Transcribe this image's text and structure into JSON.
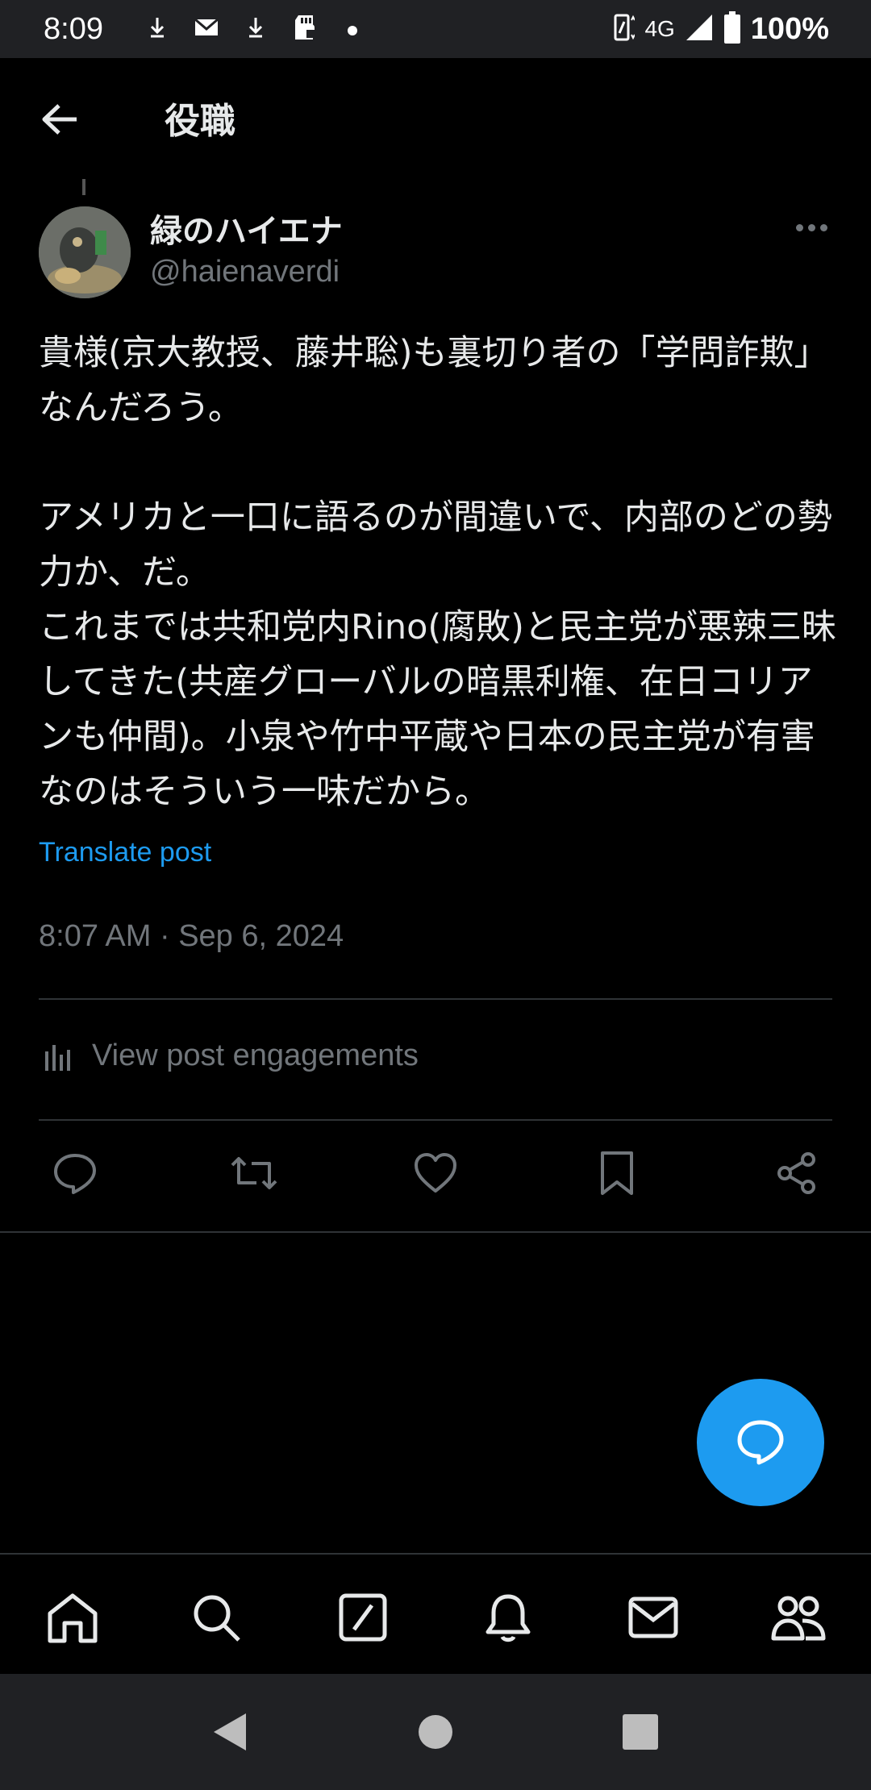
{
  "status_bar": {
    "time": "8:09",
    "network": "4G",
    "battery": "100%",
    "icons": [
      "download-icon",
      "mail-icon",
      "download-icon",
      "sd-card-icon",
      "dot-icon",
      "nfc-icon",
      "signal-icon",
      "battery-icon"
    ]
  },
  "header": {
    "title": "役職",
    "back_icon": "arrow-left-icon"
  },
  "post": {
    "author_name": "緑のハイエナ",
    "author_handle": "@haienaverdi",
    "text": "貴様(京大教授、藤井聡)も裏切り者の「学問詐欺」なんだろう。\n\nアメリカと一口に語るのが間違いで、内部のどの勢力か、だ。\nこれまでは共和党内Rino(腐敗)と民主党が悪辣三昧してきた(共産グローバルの暗黒利権、在日コリアンも仲間)。小泉や竹中平蔵や日本の民主党が有害なのはそういう一味だから。",
    "translate_label": "Translate post",
    "timestamp": "8:07 AM · Sep 6, 2024",
    "engagements_label": "View post engagements"
  },
  "actions": [
    "reply-icon",
    "repost-icon",
    "like-icon",
    "bookmark-icon",
    "share-icon"
  ],
  "bottom_nav": [
    "home-icon",
    "search-icon",
    "grok-icon",
    "notifications-icon",
    "messages-icon",
    "communities-icon"
  ],
  "colors": {
    "background": "#000000",
    "accent": "#1d9bf0",
    "text_primary": "#e7e9ea",
    "text_secondary": "#71767b",
    "divider": "#2f3336",
    "system_bar": "#202124"
  }
}
